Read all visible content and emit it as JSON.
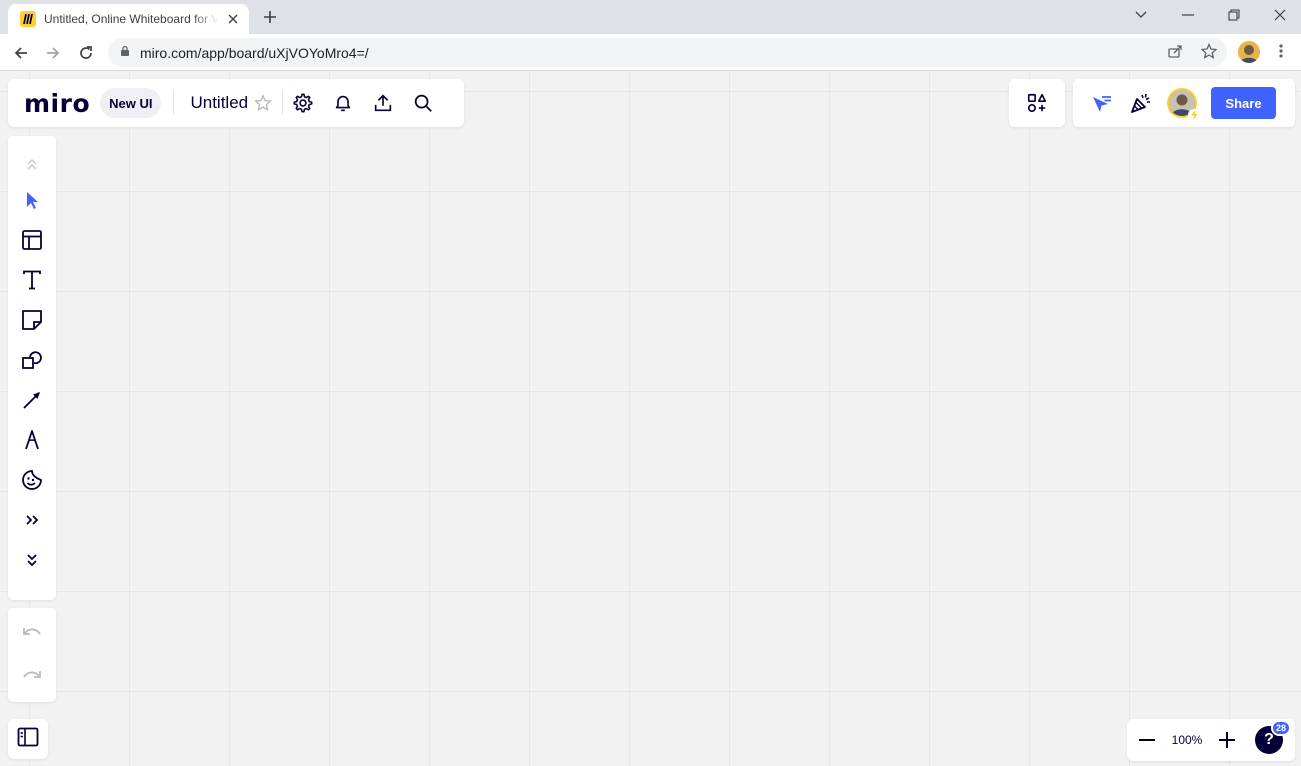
{
  "browser": {
    "tab_title": "Untitled, Online Whiteboard for Visual Collaboration",
    "url": "miro.com/app/board/uXjVOYoMro4=/"
  },
  "board": {
    "logo": "miro",
    "new_ui_label": "New UI",
    "title": "Untitled",
    "share_label": "Share",
    "zoom_level": "100%",
    "help_symbol": "?",
    "notification_count": "28"
  },
  "colors": {
    "accent": "#4262ff",
    "brand_yellow": "#ffd02f",
    "ink": "#050038",
    "canvas": "#f2f2f2"
  },
  "toolbar_icons": [
    "collapse-up-icon",
    "select-cursor-icon",
    "templates-icon",
    "text-icon",
    "sticky-note-icon",
    "shapes-icon",
    "connection-line-icon",
    "pen-icon",
    "stickers-icon",
    "more-tools-icon",
    "expand-down-icon"
  ]
}
